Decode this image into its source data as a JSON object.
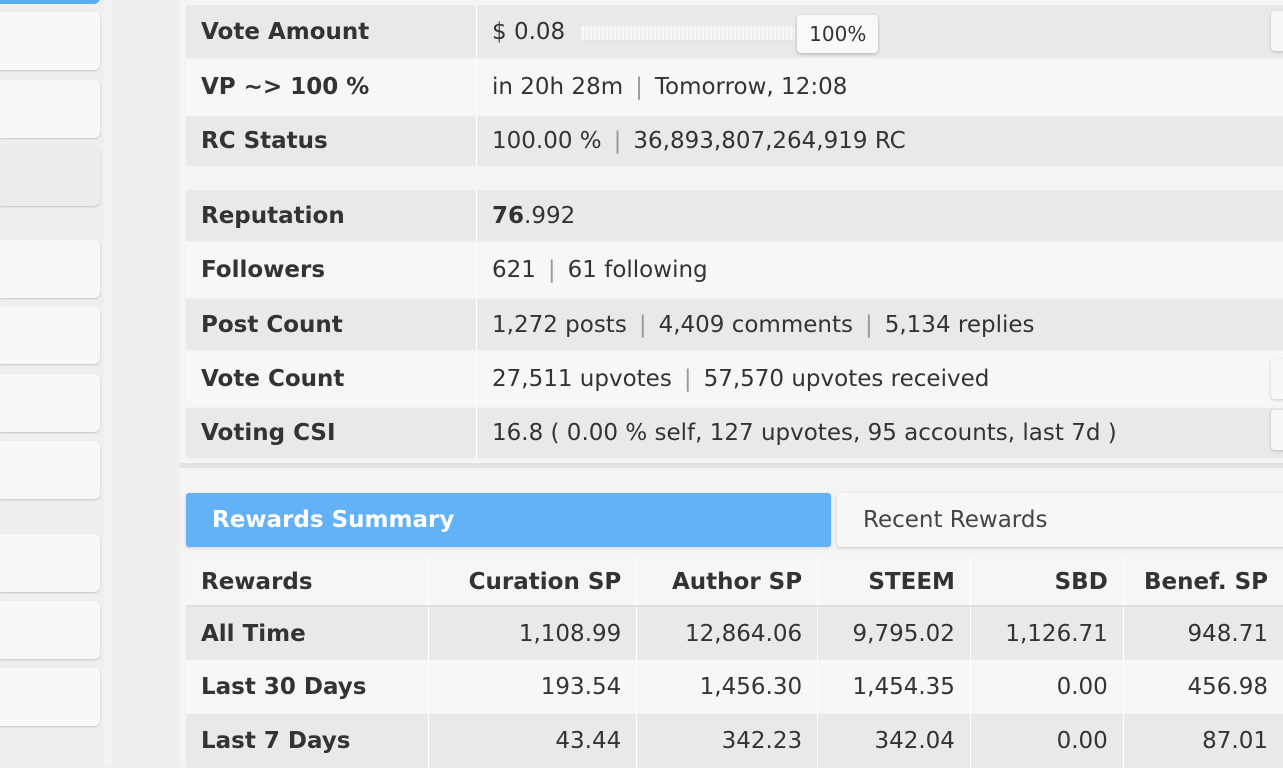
{
  "vote_amount": {
    "label": "Vote Amount",
    "value": "$ 0.08",
    "percent": "100%"
  },
  "vp": {
    "label": "VP ~> 100 %",
    "eta": "in 20h 28m",
    "when": "Tomorrow, 12:08"
  },
  "rc": {
    "label": "RC Status",
    "percent": "100.00 %",
    "amount": "36,893,807,264,919 RC"
  },
  "reputation": {
    "label": "Reputation",
    "major": "76",
    "minor": ".992"
  },
  "followers": {
    "label": "Followers",
    "count": "621",
    "following": "61 following"
  },
  "posts": {
    "label": "Post Count",
    "posts": "1,272 posts",
    "comments": "4,409 comments",
    "replies": "5,134 replies"
  },
  "votes": {
    "label": "Vote Count",
    "upvotes": "27,511 upvotes",
    "received": "57,570 upvotes received"
  },
  "csi": {
    "label": "Voting CSI",
    "value": "16.8 ( 0.00 % self, 127 upvotes, 95 accounts, last 7d )"
  },
  "sep": "|",
  "tabs": {
    "active": "Rewards Summary",
    "inactive": "Recent Rewards"
  },
  "rewards": {
    "headers": [
      "Rewards",
      "Curation SP",
      "Author SP",
      "STEEM",
      "SBD",
      "Benef. SP"
    ],
    "rows": [
      [
        "All Time",
        "1,108.99",
        "12,864.06",
        "9,795.02",
        "1,126.71",
        "948.71"
      ],
      [
        "Last 30 Days",
        "193.54",
        "1,456.30",
        "1,454.35",
        "0.00",
        "456.98"
      ],
      [
        "Last 7 Days",
        "43.44",
        "342.23",
        "342.04",
        "0.00",
        "87.01"
      ]
    ]
  },
  "colors": {
    "accent": "#63b1f6",
    "row_dark": "#e9e9e9",
    "row_light": "#f7f7f7"
  }
}
